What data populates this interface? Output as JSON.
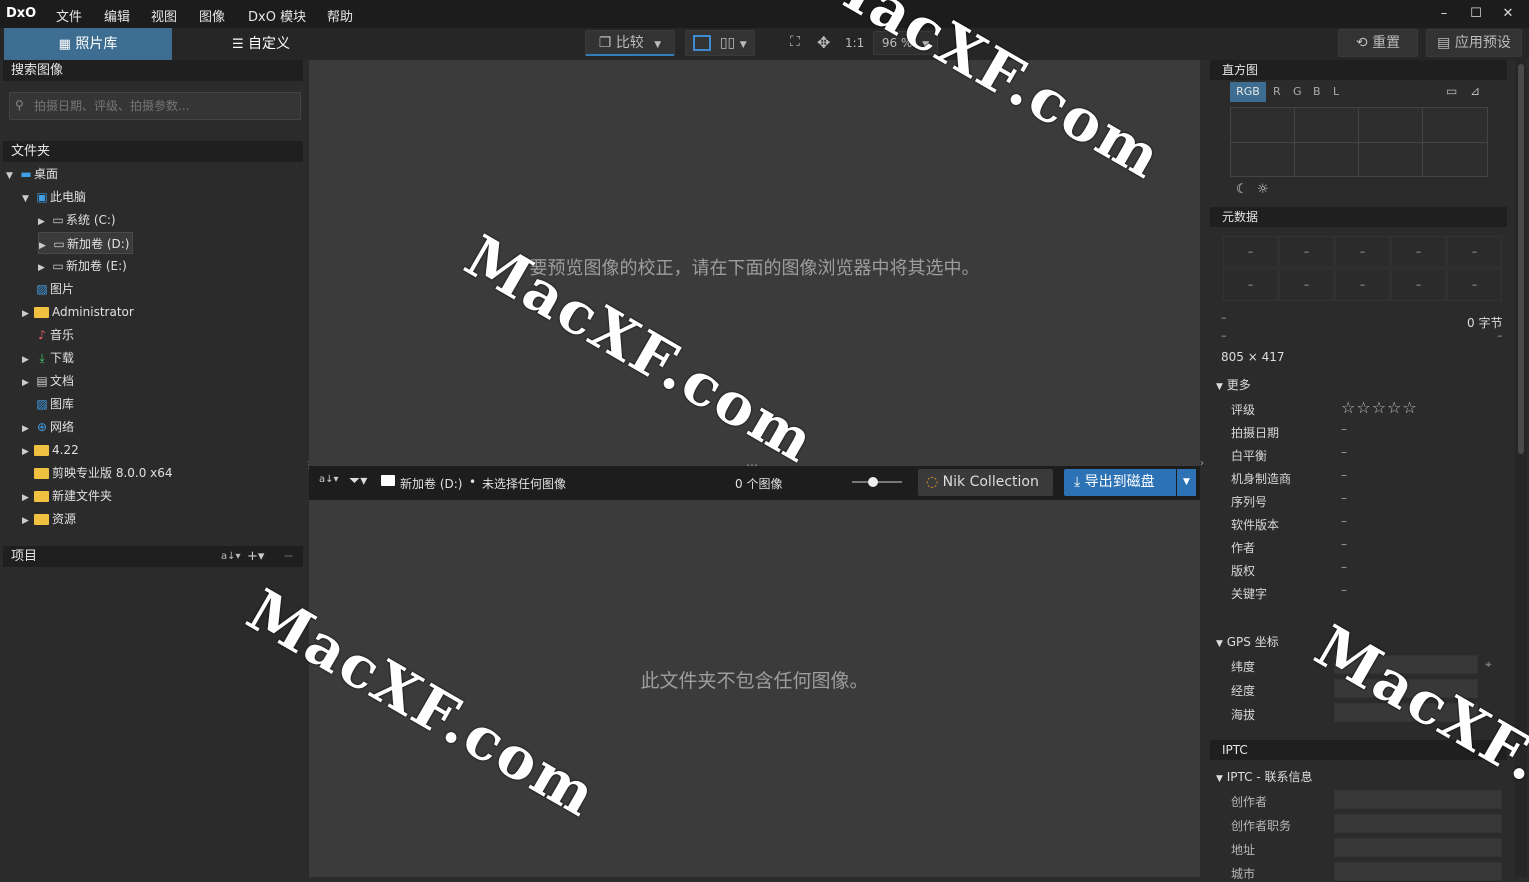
{
  "app": {
    "logo": "DxO"
  },
  "menu": [
    "文件",
    "编辑",
    "视图",
    "图像",
    "DxO 模块",
    "帮助"
  ],
  "window_controls": {
    "minimize": "–",
    "maximize": "☐",
    "close": "✕"
  },
  "toolbar": {
    "tab_library": "照片库",
    "tab_customize": "自定义",
    "compare": "比较",
    "ratio": "1:1",
    "zoom": "96 %",
    "reset": "重置",
    "apply_preset": "应用预设"
  },
  "left": {
    "search_title": "搜索图像",
    "search_placeholder": "拍摄日期、评级、拍摄参数...",
    "folders_title": "文件夹",
    "tree": [
      {
        "label": "桌面",
        "expand": "▼",
        "icon": "desktop-icon"
      },
      {
        "label": "此电脑",
        "expand": "▼",
        "icon": "computer-icon"
      },
      {
        "label": "系统 (C:)",
        "expand": "▶",
        "icon": "drive-icon"
      },
      {
        "label": "新加卷 (D:)",
        "expand": "▶",
        "icon": "drive-icon",
        "selected": true
      },
      {
        "label": "新加卷 (E:)",
        "expand": "▶",
        "icon": "drive-icon"
      },
      {
        "label": "图片",
        "expand": "",
        "icon": "pictures-icon"
      },
      {
        "label": "Administrator",
        "expand": "▶",
        "icon": "folder-icon"
      },
      {
        "label": "音乐",
        "expand": "",
        "icon": "music-icon"
      },
      {
        "label": "下载",
        "expand": "▶",
        "icon": "download-icon"
      },
      {
        "label": "文档",
        "expand": "▶",
        "icon": "documents-icon"
      },
      {
        "label": "图库",
        "expand": "",
        "icon": "gallery-icon"
      },
      {
        "label": "网络",
        "expand": "▶",
        "icon": "network-icon"
      },
      {
        "label": "4.22",
        "expand": "▶",
        "icon": "folder-icon"
      },
      {
        "label": "剪映专业版 8.0.0 x64",
        "expand": "",
        "icon": "folder-icon"
      },
      {
        "label": "新建文件夹",
        "expand": "▶",
        "icon": "folder-icon"
      },
      {
        "label": "资源",
        "expand": "▶",
        "icon": "folder-icon"
      }
    ],
    "projects_title": "项目"
  },
  "viewer": {
    "message": "要预览图像的校正，请在下面的图像浏览器中将其选中。"
  },
  "filmstrip": {
    "path": "新加卷 (D:)",
    "separator": "•",
    "selection": "未选择任何图像",
    "count": "0 个图像",
    "nik": "Nik Collection",
    "export": "导出到磁盘"
  },
  "browser": {
    "empty": "此文件夹不包含任何图像。"
  },
  "right": {
    "histogram_title": "直方图",
    "channels": [
      "RGB",
      "R",
      "G",
      "B",
      "L"
    ],
    "metadata_title": "元数据",
    "dash": "–",
    "size_bytes": "0 字节",
    "dimensions": "805 × 417",
    "more": "更多",
    "rating_label": "评级",
    "stars": "☆☆☆☆☆",
    "meta_rows": [
      "拍摄日期",
      "白平衡",
      "机身制造商",
      "序列号",
      "软件版本",
      "作者",
      "版权",
      "关键字"
    ],
    "gps": "GPS 坐标",
    "gps_rows": [
      "纬度",
      "经度",
      "海拔"
    ],
    "iptc_title": "IPTC",
    "iptc_sub": "IPTC - 联系信息",
    "iptc_rows": [
      "创作者",
      "创作者职务",
      "地址",
      "城市"
    ]
  },
  "watermark": "MacXF.com",
  "colors": {
    "accent": "#2f7fbf",
    "tab_active": "#3d6e92",
    "export": "#2c72b5"
  }
}
